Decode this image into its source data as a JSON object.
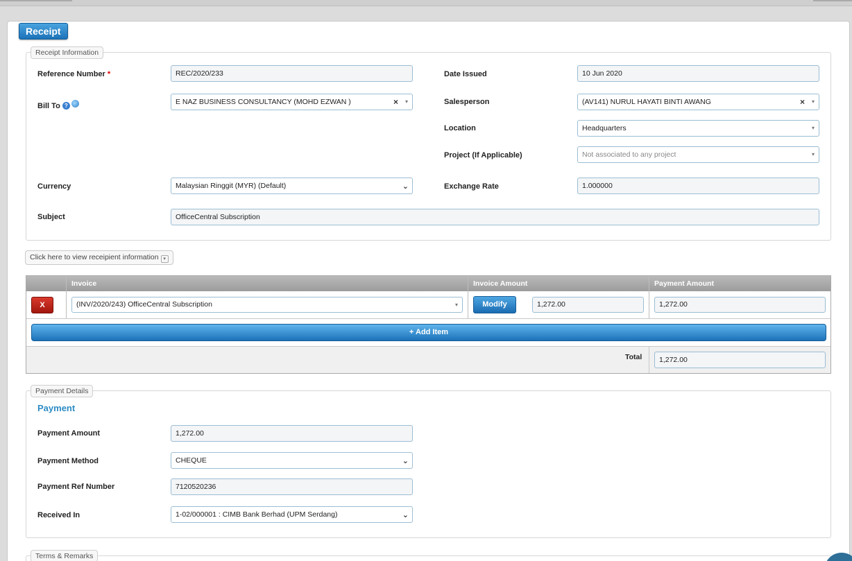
{
  "page": {
    "title": "Receipt"
  },
  "receipt_info": {
    "legend": "Receipt Information",
    "reference_number": {
      "label": "Reference Number",
      "required_mark": "*",
      "value": "REC/2020/233"
    },
    "bill_to": {
      "label": "Bill To",
      "value": "E NAZ BUSINESS CONSULTANCY (MOHD EZWAN )",
      "clear": "×",
      "help_icon": "?"
    },
    "currency": {
      "label": "Currency",
      "value": "Malaysian Ringgit (MYR) (Default)"
    },
    "subject": {
      "label": "Subject",
      "value": "OfficeCentral Subscription"
    },
    "date_issued": {
      "label": "Date Issued",
      "value": "10 Jun 2020"
    },
    "salesperson": {
      "label": "Salesperson",
      "value": "(AV141) NURUL HAYATI BINTI AWANG",
      "clear": "×"
    },
    "location": {
      "label": "Location",
      "value": "Headquarters"
    },
    "project": {
      "label": "Project (If Applicable)",
      "placeholder": "Not associated to any project"
    },
    "exchange_rate": {
      "label": "Exchange Rate",
      "value": "1.000000"
    }
  },
  "recipient_toggle": {
    "label": "Click here to view receipient information"
  },
  "items_grid": {
    "columns": [
      "Invoice",
      "Invoice Amount",
      "Payment Amount"
    ],
    "rows": [
      {
        "delete_label": "X",
        "invoice": "(INV/2020/243) OfficeCentral Subscription",
        "modify_label": "Modify",
        "invoice_amount": "1,272.00",
        "payment_amount": "1,272.00"
      }
    ],
    "add_item_label": "+ Add Item",
    "total_label": "Total",
    "total_value": "1,272.00"
  },
  "payment_details": {
    "legend": "Payment Details",
    "section_title": "Payment",
    "payment_amount": {
      "label": "Payment Amount",
      "value": "1,272.00"
    },
    "payment_method": {
      "label": "Payment Method",
      "value": "CHEQUE"
    },
    "payment_ref": {
      "label": "Payment Ref Number",
      "value": "7120520236"
    },
    "received_in": {
      "label": "Received In",
      "value": "1-02/000001 : CIMB Bank Berhad (UPM Serdang)"
    }
  },
  "terms": {
    "legend": "Terms & Remarks"
  },
  "icons": {
    "caret": "▾",
    "chevron": "⌄",
    "clear": "×"
  }
}
